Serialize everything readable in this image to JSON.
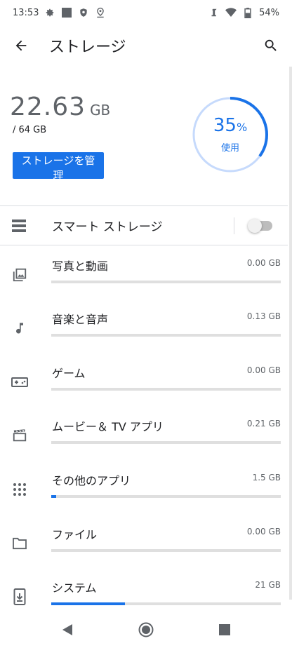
{
  "status_bar": {
    "time": "13:53",
    "battery": "54%",
    "left_icons": [
      "gear-icon",
      "square-icon",
      "shield-icon",
      "location-pin-icon"
    ],
    "right_icons": [
      "font-scale-icon",
      "wifi-icon",
      "battery-icon"
    ]
  },
  "app_bar": {
    "title": "ストレージ",
    "back_icon": "arrow-left-icon",
    "search_icon": "search-icon"
  },
  "summary": {
    "used": "22.63",
    "used_unit": "GB",
    "total": "/ 64 GB",
    "percent": "35",
    "percent_sign": "%",
    "percent_label": "使用",
    "percent_value": 0.35,
    "manage_button": "ストレージを管理"
  },
  "smart_storage": {
    "label": "スマート ストレージ",
    "enabled": false,
    "icon": "list-icon"
  },
  "categories": [
    {
      "label": "写真と動画",
      "size": "0.00 GB",
      "fraction": 0.0,
      "icon": "photo-icon"
    },
    {
      "label": "音楽と音声",
      "size": "0.13 GB",
      "fraction": 0.0,
      "icon": "music-note-icon"
    },
    {
      "label": "ゲーム",
      "size": "0.00 GB",
      "fraction": 0.0,
      "icon": "gamepad-icon"
    },
    {
      "label": "ムービー＆ TV アプリ",
      "size": "0.21 GB",
      "fraction": 0.0,
      "icon": "movie-icon"
    },
    {
      "label": "その他のアプリ",
      "size": "1.5 GB",
      "fraction": 0.02,
      "icon": "apps-grid-icon"
    },
    {
      "label": "ファイル",
      "size": "0.00 GB",
      "fraction": 0.0,
      "icon": "folder-icon"
    },
    {
      "label": "システム",
      "size": "21 GB",
      "fraction": 0.32,
      "icon": "system-update-icon"
    }
  ],
  "nav": {
    "back": "nav-back-icon",
    "home": "nav-home-icon",
    "recents": "nav-recents-icon"
  },
  "colors": {
    "accent": "#1a73e8",
    "ring_track": "#c6dafc",
    "bar_track": "#dfdfdf"
  }
}
